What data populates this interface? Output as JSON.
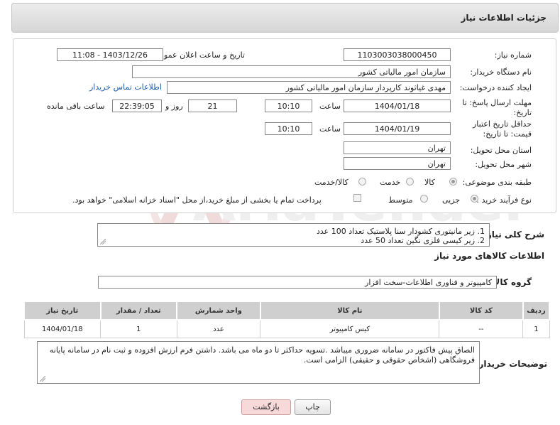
{
  "header": {
    "title": "جزئیات اطلاعات نیاز"
  },
  "need_number": {
    "label": "شماره نیاز:",
    "value": "1103003038000450"
  },
  "announce": {
    "label": "تاریخ و ساعت اعلان عمومی:",
    "value": "1403/12/26 - 11:08"
  },
  "buyer_org": {
    "label": "نام دستگاه خریدار:",
    "value": "سازمان امور مالیاتی کشور"
  },
  "creator": {
    "label": "ایجاد کننده درخواست:",
    "value": "مهدی غیاثوند کارپرداز سازمان امور مالیاتی کشور",
    "contact_link": "اطلاعات تماس خریدار"
  },
  "reply_deadline": {
    "label": "مهلت ارسال پاسخ: تا تاریخ:",
    "date": "1404/01/18",
    "time_label": "ساعت",
    "time": "10:10",
    "days": "21",
    "days_label": "روز و",
    "remaining": "22:39:05",
    "remaining_label": "ساعت باقی مانده"
  },
  "price_validity": {
    "label": "حداقل تاریخ اعتبار قیمت: تا تاریخ:",
    "date": "1404/01/19",
    "time_label": "ساعت",
    "time": "10:10"
  },
  "delivery_province": {
    "label": "استان محل تحویل:",
    "value": "تهران"
  },
  "delivery_city": {
    "label": "شهر محل تحویل:",
    "value": "تهران"
  },
  "category": {
    "label": "طبقه بندی موضوعی:",
    "options": [
      "کالا",
      "خدمت",
      "کالا/خدمت"
    ],
    "selected": "کالا"
  },
  "purchase_type": {
    "label": "نوع فرآیند خرید :",
    "options": [
      "جزیی",
      "متوسط"
    ],
    "selected": "جزیی",
    "payment_note": "پرداخت تمام یا بخشی از مبلغ خرید،از محل \"اسناد خزانه اسلامی\" خواهد بود."
  },
  "general_desc": {
    "label": "شرح کلی نیاز:",
    "lines": [
      "1. زیر مانیتوری کشودار سنا پلاستیک تعداد 100 عدد",
      "2. زیر کیسی فلزی نگین تعداد 50 عدد"
    ]
  },
  "goods_info": {
    "title": "اطلاعات کالاهای مورد نیاز"
  },
  "goods_group": {
    "label": "گروه کالا:",
    "value": "کامپیوتر و فناوری اطلاعات-سخت افزار"
  },
  "table": {
    "headers": [
      "ردیف",
      "کد کالا",
      "نام کالا",
      "واحد شمارش",
      "تعداد / مقدار",
      "تاریخ نیاز"
    ],
    "rows": [
      [
        "1",
        "--",
        "کیس کامپیوتر",
        "عدد",
        "1",
        "1404/01/18"
      ]
    ]
  },
  "buyer_notes": {
    "label": "توضیحات خریدار:",
    "text": "الصاق پیش فاکتور در سامانه ضروری میباشد .تسویه حداکثر تا دو ماه می باشد.  داشتن فرم ارزش افزوده و ثبت نام در سامانه پایانه فروشگاهی (اشخاص حقوقی و حقیقی) الزامی است."
  },
  "buttons": {
    "print": "چاپ",
    "back": "بازگشت"
  },
  "colors": {
    "header_bg": "#dcdcdc",
    "link": "#1a5ca8",
    "back_button_bg": "#f7d9d9",
    "table_header_bg": "#cfcfcf"
  }
}
